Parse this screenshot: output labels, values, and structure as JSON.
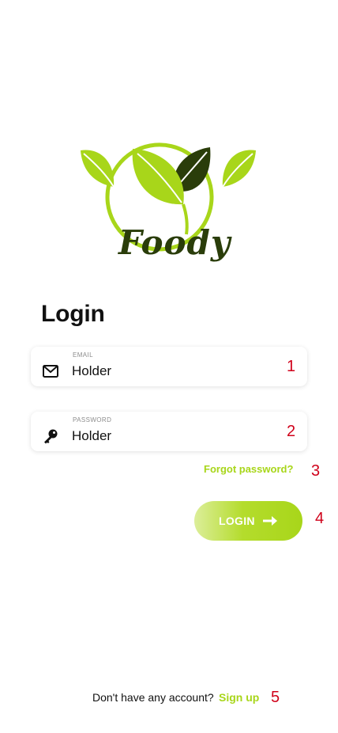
{
  "logo": {
    "brand_text": "Foody",
    "colors": {
      "light_green": "#a8d61a",
      "dark_green": "#2a3d0a"
    }
  },
  "login": {
    "title": "Login",
    "email": {
      "label": "EMAIL",
      "value": "Holder",
      "icon": "mail-icon"
    },
    "password": {
      "label": "PASSWORD",
      "value": "Holder",
      "icon": "key-icon"
    },
    "forgot_password": "Forgot password?",
    "button": {
      "label": "LOGIN",
      "icon": "arrow-right-icon"
    }
  },
  "footer": {
    "prompt": "Don't have any account?",
    "signup_link": "Sign up"
  },
  "annotations": [
    "1",
    "2",
    "3",
    "4",
    "5"
  ],
  "colors": {
    "accent": "#a8d61a",
    "annotation": "#d0021b"
  }
}
